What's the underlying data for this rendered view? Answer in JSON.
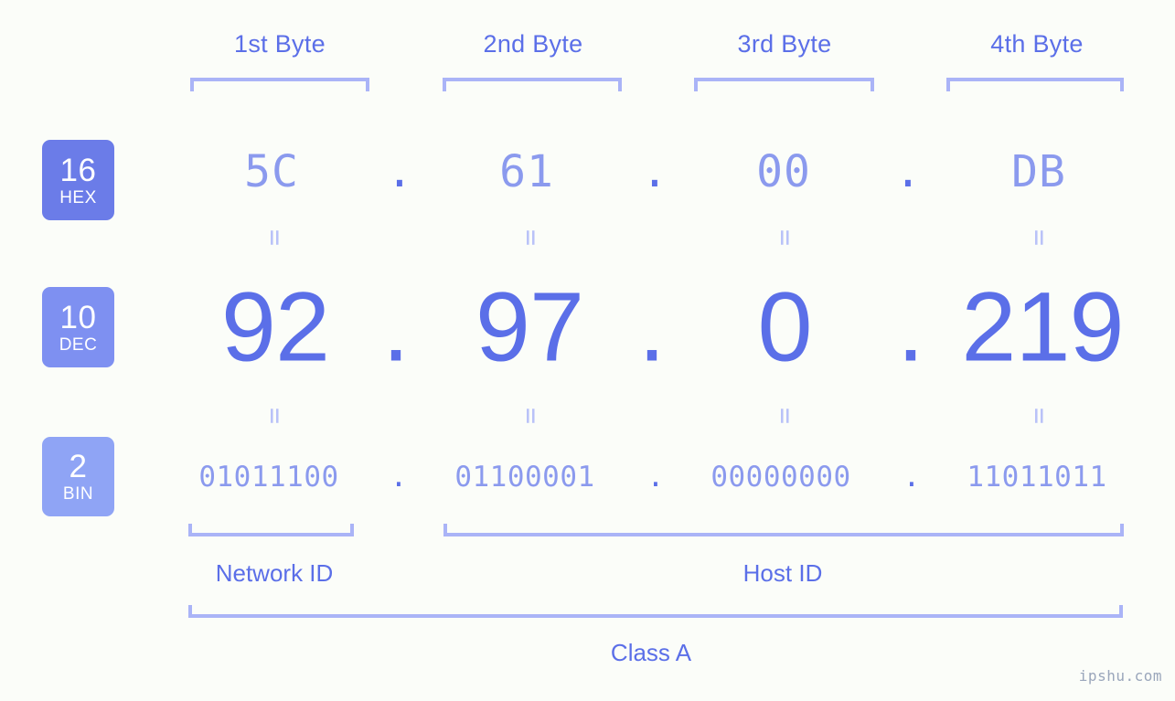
{
  "ip": {
    "dotted_decimal": "92.97.0.219",
    "class": "Class A",
    "separator": "."
  },
  "byte_headers": [
    {
      "label": "1st Byte"
    },
    {
      "label": "2nd Byte"
    },
    {
      "label": "3rd Byte"
    },
    {
      "label": "4th Byte"
    }
  ],
  "radix_badges": [
    {
      "base": "16",
      "name": "HEX",
      "color": "#6b7ce8"
    },
    {
      "base": "10",
      "name": "DEC",
      "color": "#7e90f1"
    },
    {
      "base": "2",
      "name": "BIN",
      "color": "#8fa4f5"
    }
  ],
  "rows": {
    "hex": {
      "label": "HEX",
      "values": [
        "5C",
        "61",
        "00",
        "DB"
      ]
    },
    "dec": {
      "label": "DEC",
      "values": [
        "92",
        "97",
        "0",
        "219"
      ]
    },
    "bin": {
      "label": "BIN",
      "values": [
        "01011100",
        "01100001",
        "00000000",
        "11011011"
      ]
    }
  },
  "equals_symbol": "=",
  "sections": [
    {
      "label": "Network ID"
    },
    {
      "label": "Host ID"
    }
  ],
  "class_label": "Class A",
  "watermark": "ipshu.com",
  "colors": {
    "background": "#fbfdf9",
    "accent_strong": "#5b6fe8",
    "accent_light": "#8b9aee",
    "bracket": "#aab4f7",
    "connector": "#b9c2f8"
  }
}
